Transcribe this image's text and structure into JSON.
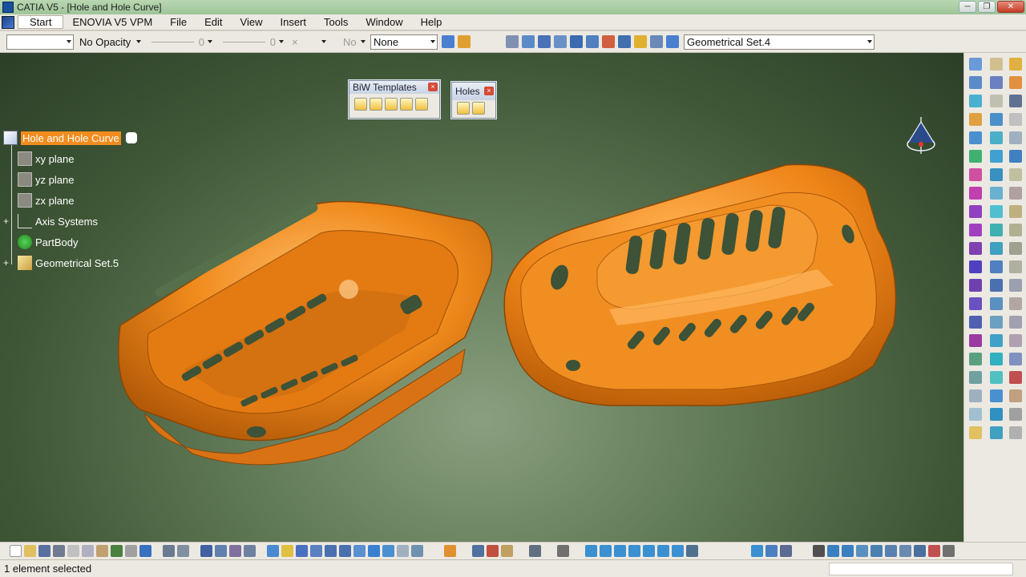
{
  "title_bar": {
    "title": "CATIA V5 - [Hole and Hole Curve]"
  },
  "menu": {
    "items": [
      "Start",
      "ENOVIA V5 VPM",
      "File",
      "Edit",
      "View",
      "Insert",
      "Tools",
      "Window",
      "Help"
    ]
  },
  "format_toolbar": {
    "name_combo": "",
    "opacity": "No Opacity",
    "line_weight": "0",
    "line_type": "0",
    "point_symbol": "×",
    "layer_no": "No",
    "layer": "None",
    "current_set": "Geometrical Set.4"
  },
  "tree": {
    "root": "Hole and Hole Curve",
    "children": [
      "xy plane",
      "yz plane",
      "zx plane",
      "Axis Systems",
      "PartBody",
      "Geometrical Set.5"
    ]
  },
  "floating_toolbars": {
    "biw": {
      "title": "BiW Templates",
      "close": "×"
    },
    "holes": {
      "title": "Holes",
      "close": "×"
    }
  },
  "status": {
    "text": "1 element selected"
  },
  "colors": {
    "part": "#f28c1e",
    "selection": "#f28c1e",
    "viewport_top": "#2b3f27",
    "viewport_bottom": "#8a9f7f"
  }
}
